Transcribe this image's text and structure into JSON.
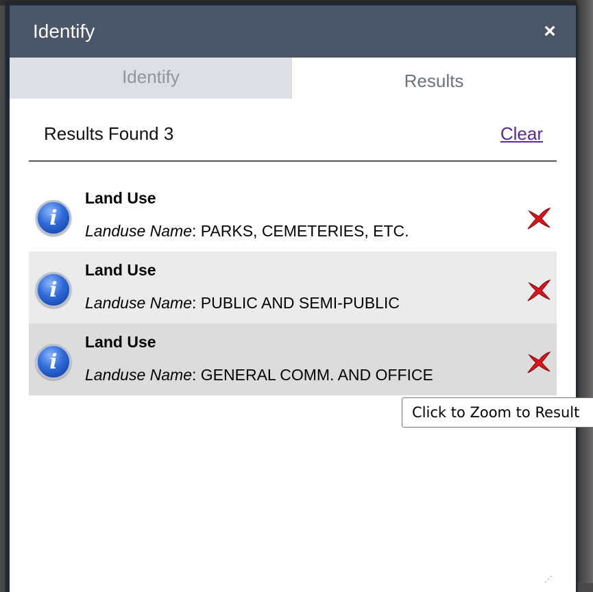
{
  "window": {
    "title": "Identify",
    "close_label": "×"
  },
  "tabs": [
    {
      "label": "Identify",
      "active": false
    },
    {
      "label": "Results",
      "active": true
    }
  ],
  "results_header": {
    "found_text": "Results Found 3",
    "clear_label": "Clear"
  },
  "results": [
    {
      "title": "Land Use",
      "field": "Landuse Name",
      "value": ": PARKS, CEMETERIES, ETC."
    },
    {
      "title": "Land Use",
      "field": "Landuse Name",
      "value": ": PUBLIC AND SEMI-PUBLIC"
    },
    {
      "title": "Land Use",
      "field": "Landuse Name",
      "value": ": GENERAL COMM. AND OFFICE"
    }
  ],
  "tooltip": {
    "text": "Click to Zoom to Result"
  },
  "icons": {
    "info": "info-icon",
    "remove": "red-x-icon",
    "close": "close-icon"
  },
  "colors": {
    "titlebar": "#4a5568",
    "clear_link": "#5a2b8f",
    "remove": "#e0141e"
  }
}
